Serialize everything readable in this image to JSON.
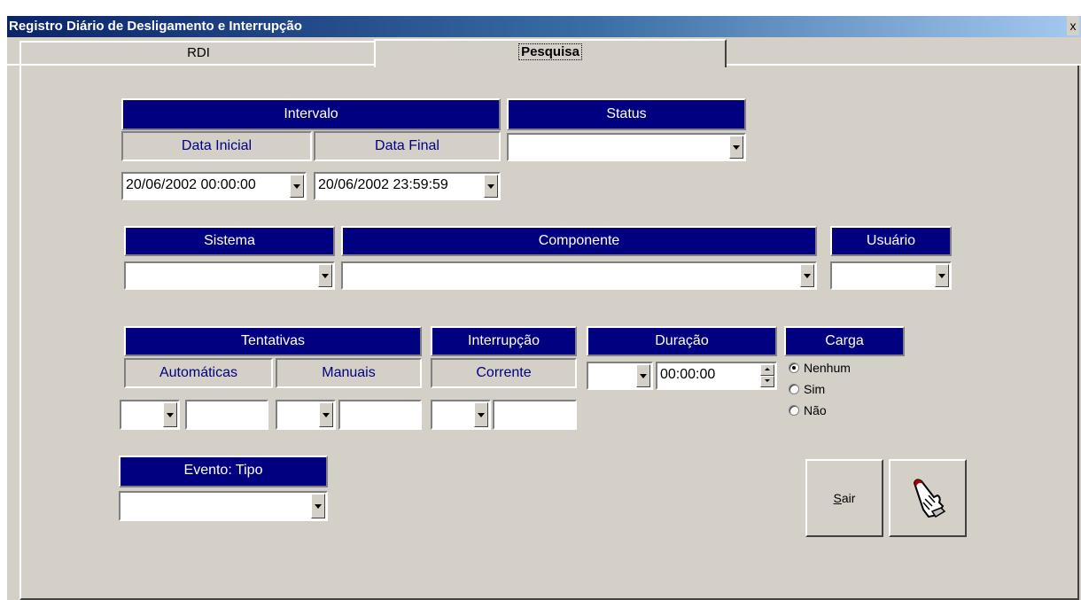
{
  "window": {
    "title": "Registro Diário de Desligamento e Interrupção",
    "close": "x"
  },
  "tabs": [
    {
      "label": "RDI"
    },
    {
      "label": "Pesquisa"
    }
  ],
  "intervalo": {
    "header": "Intervalo",
    "data_inicial_label": "Data Inicial",
    "data_final_label": "Data Final",
    "data_inicial_value": "20/06/2002 00:00:00",
    "data_final_value": "20/06/2002 23:59:59"
  },
  "status": {
    "header": "Status",
    "value": ""
  },
  "sistema": {
    "header": "Sistema",
    "value": ""
  },
  "componente": {
    "header": "Componente",
    "value": ""
  },
  "usuario": {
    "header": "Usuário",
    "value": ""
  },
  "tentativas": {
    "header": "Tentativas",
    "automaticas_label": "Automáticas",
    "manuais_label": "Manuais"
  },
  "interrupcao": {
    "header": "Interrupção",
    "corrente_label": "Corrente"
  },
  "duracao": {
    "header": "Duração",
    "time_value": "00:00:00"
  },
  "carga": {
    "header": "Carga",
    "options": [
      {
        "label": "Nenhum",
        "selected": true
      },
      {
        "label": "Sim",
        "selected": false
      },
      {
        "label": "Não",
        "selected": false
      }
    ]
  },
  "evento": {
    "header": "Evento: Tipo",
    "value": ""
  },
  "buttons": {
    "sair_mnemonic": "S",
    "sair_rest": "air",
    "search_icon": "hand-pointer-icon"
  }
}
